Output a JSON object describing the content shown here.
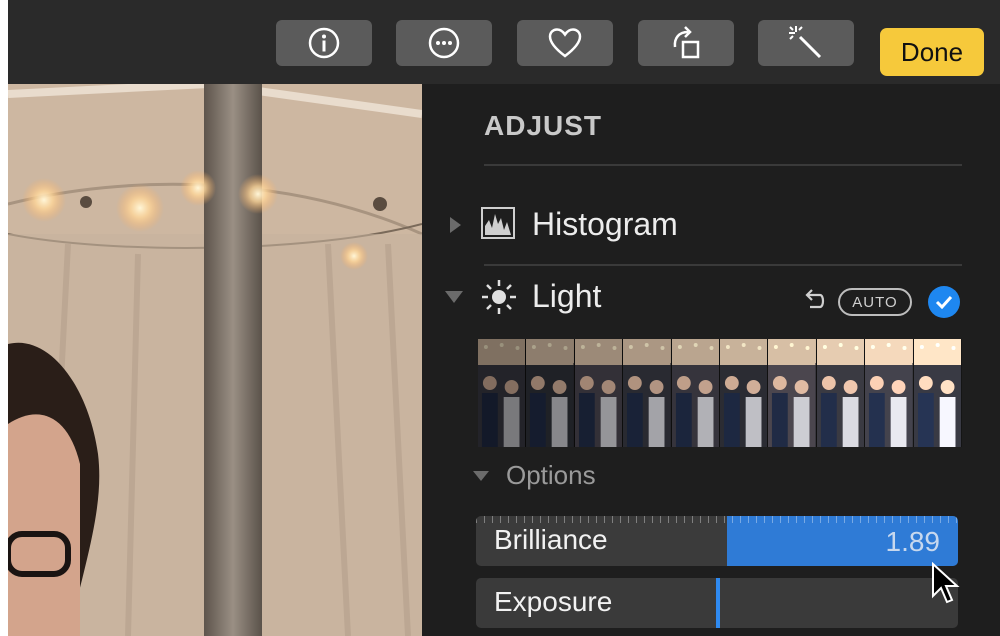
{
  "toolbar": {
    "buttons": [
      {
        "name": "info",
        "icon": "info-icon"
      },
      {
        "name": "more",
        "icon": "ellipsis-icon"
      },
      {
        "name": "favorite",
        "icon": "heart-icon"
      },
      {
        "name": "rotate",
        "icon": "rotate-icon"
      },
      {
        "name": "enhance",
        "icon": "magic-wand-icon"
      }
    ],
    "done_label": "Done"
  },
  "panel": {
    "title": "ADJUST",
    "sections": {
      "histogram": {
        "label": "Histogram",
        "icon": "histogram-icon",
        "expanded": false
      },
      "light": {
        "label": "Light",
        "icon": "sun-icon",
        "expanded": true,
        "revert_icon": "undo-icon",
        "auto_label": "AUTO",
        "enabled": true
      }
    },
    "options_label": "Options",
    "sliders": [
      {
        "label": "Brilliance",
        "value": "1.89",
        "fill_fraction": 0.48,
        "active": true
      },
      {
        "label": "Exposure",
        "value": "",
        "fill_fraction": 0.0,
        "active": false
      }
    ]
  },
  "colors": {
    "toolbar_bg": "#2a2a2a",
    "panel_bg": "#1e1e1e",
    "button_bg": "#5b5b5b",
    "done_bg": "#f6c93b",
    "accent": "#2f7bd6",
    "check": "#1e87f0"
  }
}
